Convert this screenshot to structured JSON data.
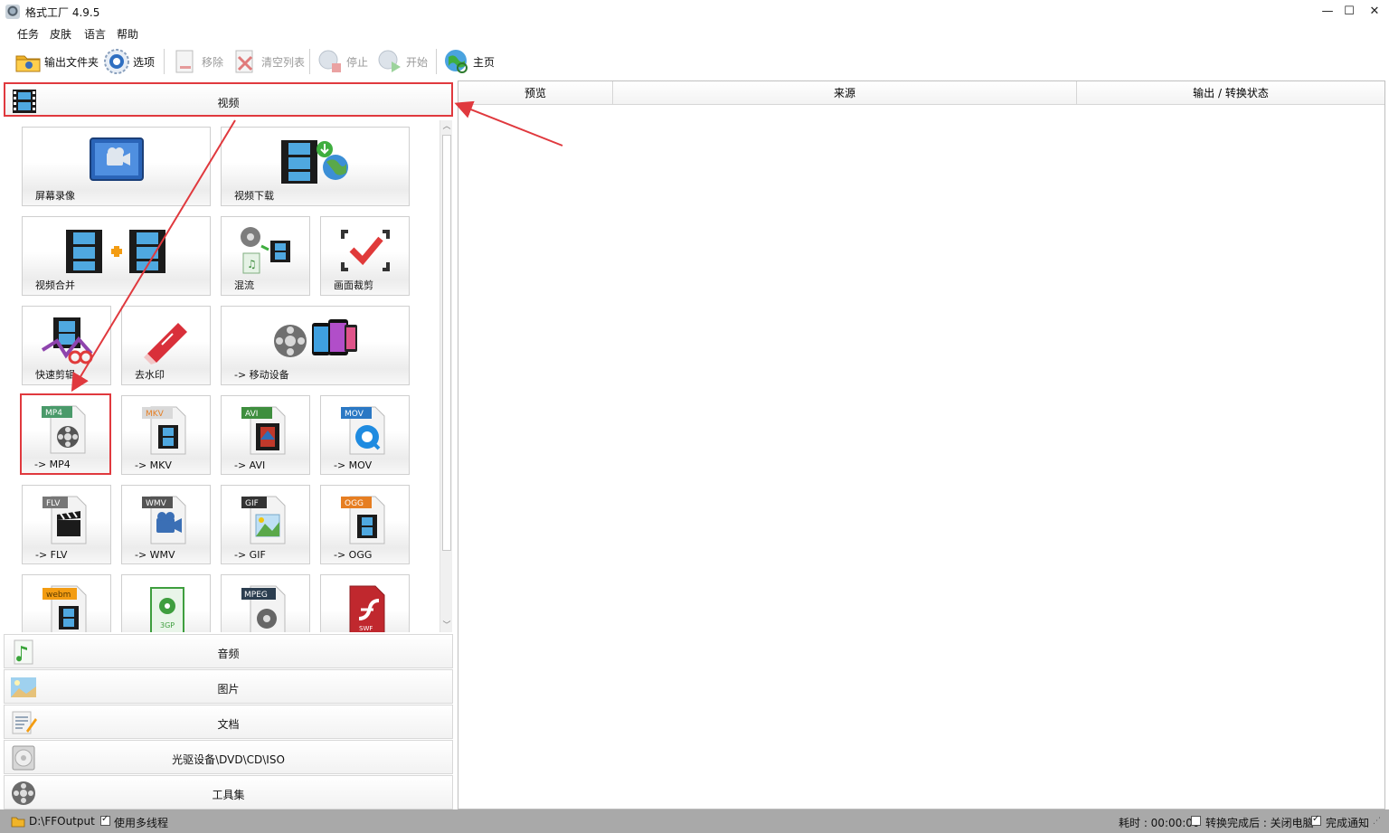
{
  "window": {
    "title": "格式工厂 4.9.5",
    "min": "—",
    "max": "☐",
    "close": "✕"
  },
  "menu": [
    "任务",
    "皮肤",
    "语言",
    "帮助"
  ],
  "toolbar": {
    "output_folder": "输出文件夹",
    "options": "选项",
    "remove": "移除",
    "clear_list": "清空列表",
    "stop": "停止",
    "start": "开始",
    "home": "主页"
  },
  "categories": {
    "video": "视频",
    "audio": "音频",
    "image": "图片",
    "document": "文档",
    "optical": "光驱设备\\DVD\\CD\\ISO",
    "tools": "工具集"
  },
  "tiles": {
    "screen_record": "屏幕录像",
    "video_download": "视频下载",
    "video_merge": "视频合并",
    "mux": "混流",
    "crop": "画面裁剪",
    "quick_clip": "快速剪辑",
    "watermark": "去水印",
    "mobile": "-> 移动设备",
    "mp4": "-> MP4",
    "mkv": "-> MKV",
    "avi": "-> AVI",
    "mov": "-> MOV",
    "flv": "-> FLV",
    "wmv": "-> WMV",
    "gif": "-> GIF",
    "ogg": "-> OGG"
  },
  "badges": {
    "mp4": "MP4",
    "mkv": "MKV",
    "avi": "AVI",
    "mov": "MOV",
    "flv": "FLV",
    "wmv": "WMV",
    "gif": "GIF",
    "ogg": "OGG",
    "webm": "webm",
    "3gp": "3GP",
    "mpeg": "MPEG",
    "swf": "SWF"
  },
  "columns": {
    "preview": "预览",
    "source": "来源",
    "output": "输出 / 转换状态"
  },
  "status": {
    "path": "D:\\FFOutput",
    "multithread": "使用多线程",
    "elapsed": "耗时 : 00:00:00",
    "after_done": "转换完成后 : 关闭电脑",
    "notify": "完成通知"
  },
  "colors": {
    "highlight": "#e0393e",
    "statusbar": "#a9a9a9"
  }
}
